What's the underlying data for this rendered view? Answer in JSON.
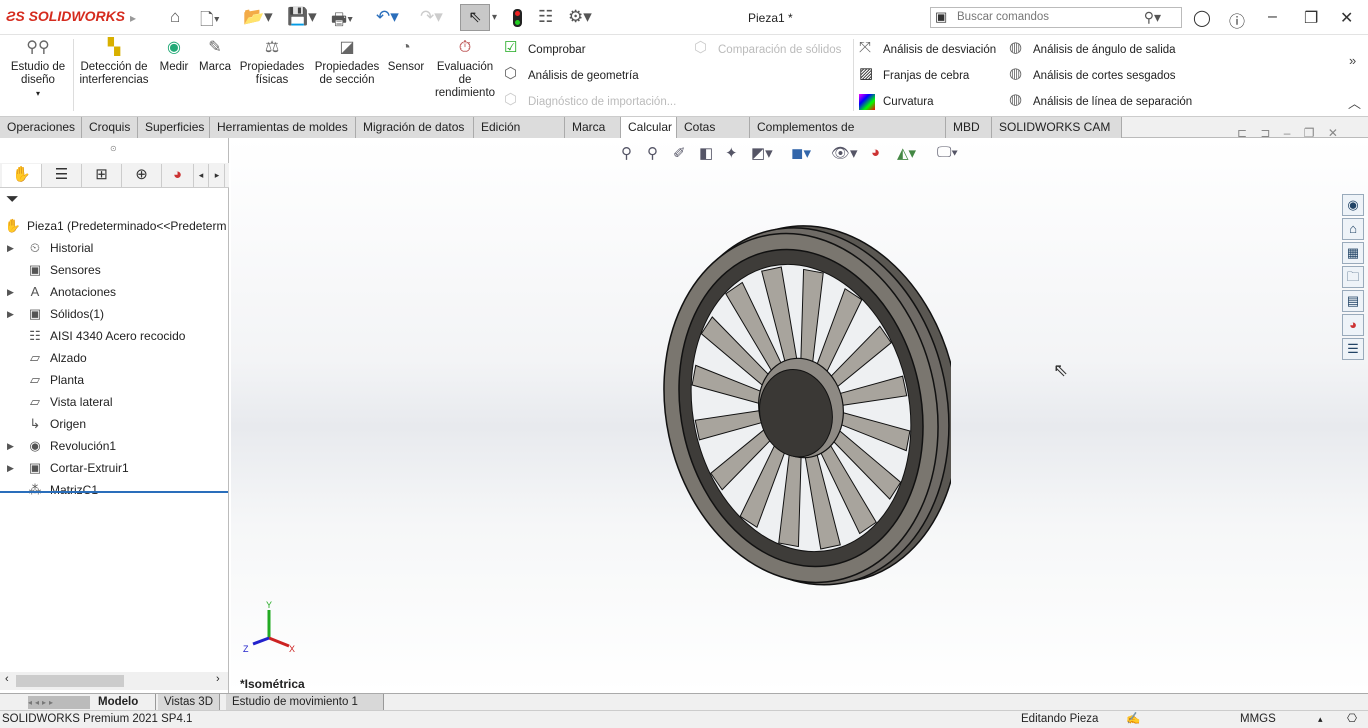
{
  "app": {
    "brand": "SOLIDWORKS",
    "title": "Pieza1 *",
    "search_placeholder": "Buscar comandos"
  },
  "ribbon": {
    "buttons": [
      {
        "label": "Estudio de diseño",
        "icon": "design-study-icon"
      },
      {
        "label": "Detección de interferencias",
        "icon": "interference-icon"
      },
      {
        "label": "Medir",
        "icon": "measure-icon"
      },
      {
        "label": "Marca",
        "icon": "markup-icon"
      },
      {
        "label": "Propiedades físicas",
        "icon": "mass-properties-icon"
      },
      {
        "label": "Propiedades de sección",
        "icon": "section-properties-icon"
      },
      {
        "label": "Sensor",
        "icon": "sensor-icon"
      },
      {
        "label": "Evaluación de rendimiento",
        "icon": "performance-icon"
      }
    ],
    "small": [
      {
        "label": "Comprobar",
        "enabled": true
      },
      {
        "label": "Análisis de geometría",
        "enabled": true
      },
      {
        "label": "Diagnóstico de importación...",
        "enabled": false
      },
      {
        "label": "Comparación de sólidos",
        "enabled": false
      },
      {
        "label": "Análisis de desviación",
        "enabled": true
      },
      {
        "label": "Franjas de cebra",
        "enabled": true
      },
      {
        "label": "Curvatura",
        "enabled": true
      },
      {
        "label": "Análisis de ángulo de salida",
        "enabled": true
      },
      {
        "label": "Análisis de cortes sesgados",
        "enabled": true
      },
      {
        "label": "Análisis de línea de separación",
        "enabled": true
      }
    ]
  },
  "tabs": [
    "Operaciones",
    "Croquis",
    "Superficies",
    "Herramientas de moldes",
    "Migración de datos",
    "Edición directa",
    "Marca",
    "Calcular",
    "Cotas MBD",
    "Complementos de SOLIDWORKS",
    "MBD",
    "SOLIDWORKS CAM"
  ],
  "active_tab": "Calcular",
  "tree": {
    "root": "Pieza1  (Predeterminado<<Predeterm",
    "items": [
      "Historial",
      "Sensores",
      "Anotaciones",
      "Sólidos(1)",
      "AISI 4340 Acero recocido",
      "Alzado",
      "Planta",
      "Vista lateral",
      "Origen",
      "Revolución1",
      "Cortar-Extruir1",
      "MatrizC1"
    ]
  },
  "view": {
    "orientation": "*Isométrica",
    "axes": {
      "x": "X",
      "y": "Y",
      "z": "Z"
    }
  },
  "bottom_tabs": [
    "Modelo",
    "Vistas 3D",
    "Estudio de movimiento 1"
  ],
  "status": {
    "version": "SOLIDWORKS Premium 2021 SP4.1",
    "mode": "Editando Pieza",
    "units": "MMGS"
  }
}
